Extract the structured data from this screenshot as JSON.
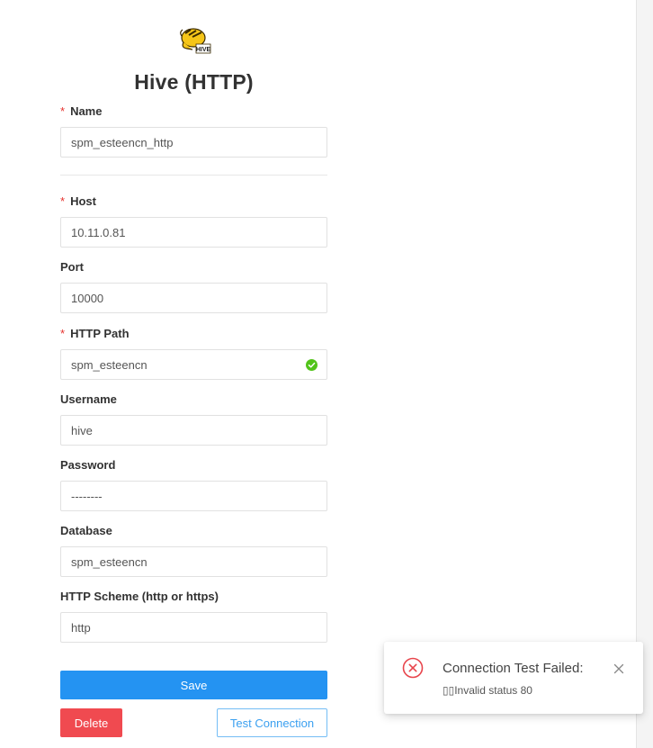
{
  "form": {
    "title": "Hive (HTTP)",
    "fields": {
      "name": {
        "label": "Name",
        "required": "*",
        "value": "spm_esteencn_http"
      },
      "host": {
        "label": "Host",
        "required": "*",
        "value": "10.11.0.81"
      },
      "port": {
        "label": "Port",
        "value": "10000"
      },
      "http_path": {
        "label": "HTTP Path",
        "required": "*",
        "value": "spm_esteencn"
      },
      "username": {
        "label": "Username",
        "value": "hive"
      },
      "password": {
        "label": "Password",
        "value": "--------"
      },
      "database": {
        "label": "Database",
        "value": "spm_esteencn"
      },
      "http_scheme": {
        "label": "HTTP Scheme (http or https)",
        "value": "http"
      }
    },
    "buttons": {
      "save": "Save",
      "delete": "Delete",
      "test_connection": "Test Connection"
    }
  },
  "notification": {
    "title": "Connection Test Failed:",
    "message": "▯▯Invalid status 80",
    "icon": "error-circle-icon",
    "close_icon": "close-icon"
  },
  "colors": {
    "primary": "#2493f2",
    "danger": "#f04a50",
    "required": "#e6322e",
    "success": "#52c41a",
    "error": "#e8454c"
  }
}
